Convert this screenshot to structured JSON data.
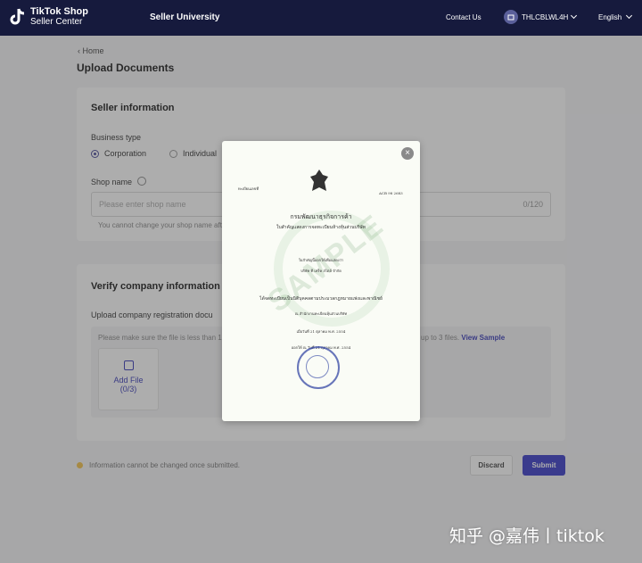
{
  "topbar": {
    "brand": "TikTok Shop",
    "brand_sub": "Seller Center",
    "nav_title": "Seller University",
    "contact": "Contact Us",
    "user": "THLCBLWL4H",
    "language": "English"
  },
  "page": {
    "breadcrumb": "Home",
    "title": "Upload Documents"
  },
  "seller_info": {
    "title": "Seller information",
    "business_type_label": "Business type",
    "options": [
      "Corporation",
      "Individual"
    ],
    "selected": "Corporation",
    "shop_name_label": "Shop name",
    "shop_name_placeholder": "Please enter shop name",
    "shop_name_count": "0/120",
    "shop_name_hint": "You cannot change your shop name aft"
  },
  "verify": {
    "title": "Verify company information",
    "upload_label": "Upload company registration docu",
    "hint_left": "Please make sure the file is less than 10",
    "hint_right": "up to 3 files.",
    "view_sample": "View Sample",
    "add_file": "Add File",
    "add_file_count": "(0/3)"
  },
  "footer": {
    "note": "Information cannot be changed once submitted.",
    "discard": "Discard",
    "submit": "Submit"
  },
  "modal": {
    "watermark": "SAMPLE",
    "doc_lines": [
      "กรมพัฒนาธุรกิจการค้า",
      "ใบสำคัญแสดงการจดทะเบียนห้างหุ้นส่วนบริษัท",
      "ใบสำคัญนี้ออกให้เพื่อแสดงว่า",
      "บริษัท ที เทร็ค สไตล์ จำกัด",
      "ได้จดทะเบียนเป็นนิติบุคคลตามประมวลกฎหมายแพ่งและพาณิชย์",
      "ณ สำนักงานทะเบียนหุ้นส่วนบริษัท",
      "เมื่อวันที่ 21 ตุลาคม พ.ศ. 2554",
      "ออกให้ ณ วันที่ 21 ตุลาคม พ.ศ. 2554"
    ],
    "doc_header_left": "ทะเบียนเลขที่",
    "doc_header_right": "ACB 98 2683"
  },
  "corner_watermark": "知乎 @嘉伟丨tiktok"
}
